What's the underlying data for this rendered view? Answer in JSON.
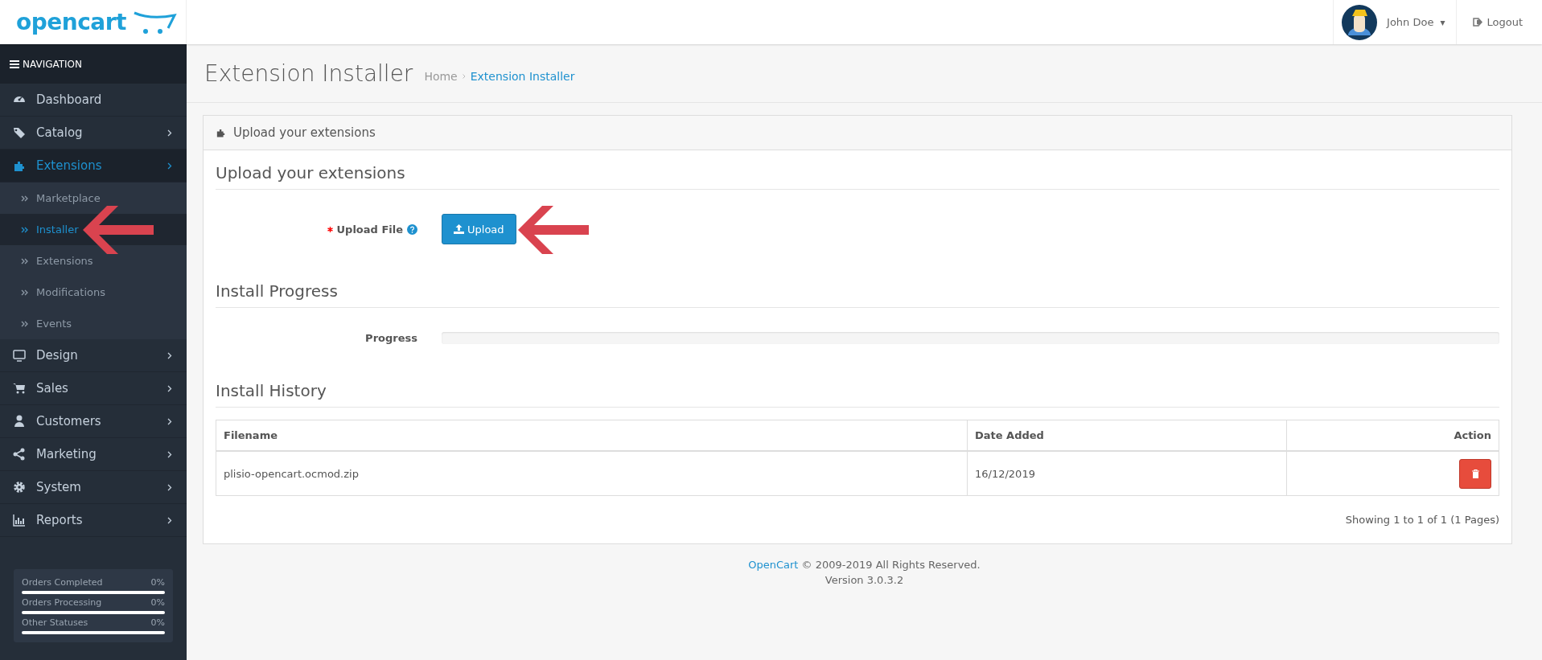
{
  "header": {
    "logo": "opencart",
    "user": {
      "name": "John Doe",
      "caret": "▾"
    },
    "logout": "Logout"
  },
  "sidebar": {
    "title": "NAVIGATION",
    "items": [
      {
        "label": "Dashboard",
        "has_children": false,
        "selected": false
      },
      {
        "label": "Catalog",
        "has_children": true,
        "selected": false
      },
      {
        "label": "Extensions",
        "has_children": true,
        "selected": true,
        "children": [
          {
            "label": "Marketplace",
            "selected": false
          },
          {
            "label": "Installer",
            "selected": true
          },
          {
            "label": "Extensions",
            "selected": false
          },
          {
            "label": "Modifications",
            "selected": false
          },
          {
            "label": "Events",
            "selected": false
          }
        ]
      },
      {
        "label": "Design",
        "has_children": true,
        "selected": false
      },
      {
        "label": "Sales",
        "has_children": true,
        "selected": false
      },
      {
        "label": "Customers",
        "has_children": true,
        "selected": false
      },
      {
        "label": "Marketing",
        "has_children": true,
        "selected": false
      },
      {
        "label": "System",
        "has_children": true,
        "selected": false
      },
      {
        "label": "Reports",
        "has_children": true,
        "selected": false
      }
    ],
    "stats": [
      {
        "label": "Orders Completed",
        "reading": "0%",
        "level": 0
      },
      {
        "label": "Orders Processing",
        "reading": "0%",
        "level": 0
      },
      {
        "label": "Other Statuses",
        "reading": "0%",
        "level": 0
      }
    ]
  },
  "page": {
    "title": "Extension Installer",
    "breadcrumb": [
      "Home",
      "Extension Installer"
    ]
  },
  "panel": {
    "heading": "Upload your extensions",
    "upload_section": {
      "legend": "Upload your extensions",
      "label": "Upload File",
      "required": true,
      "button": "Upload"
    },
    "progress_section": {
      "legend": "Install Progress",
      "label": "Progress",
      "level": 0
    },
    "history_section": {
      "legend": "Install History",
      "table": {
        "columns": [
          "Filename",
          "Date Added",
          "Action"
        ],
        "rows": [
          {
            "filename": "plisio-opencart.ocmod.zip",
            "date_added": "16/12/2019"
          }
        ]
      },
      "pagination": "Showing 1 to 1 of 1 (1 Pages)"
    }
  },
  "footer": {
    "link": "OpenCart",
    "text": "© 2009-2019 All Rights Reserved.",
    "version": "Version 3.0.3.2"
  }
}
